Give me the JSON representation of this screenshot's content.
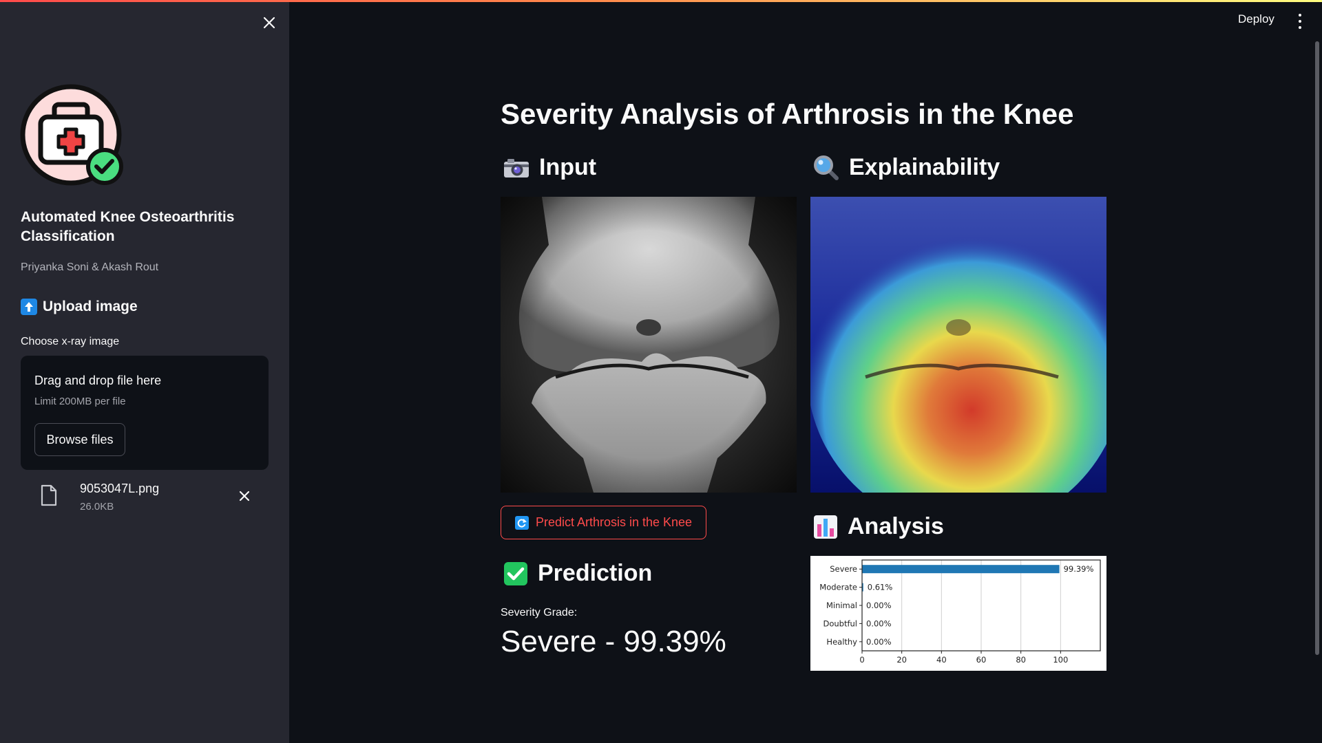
{
  "sidebar": {
    "app_title": "Automated Knee Osteoarthritis Classification",
    "authors": "Priyanka Soni & Akash Rout",
    "upload_header": "Upload image",
    "choose_label": "Choose x-ray image",
    "dropzone": {
      "title": "Drag and drop file here",
      "limit": "Limit 200MB per file",
      "browse_label": "Browse files"
    },
    "file": {
      "name": "9053047L.png",
      "size": "26.0KB"
    }
  },
  "header": {
    "deploy_label": "Deploy"
  },
  "main": {
    "title": "Severity Analysis of Arthrosis in the Knee",
    "input_header": "Input",
    "explainability_header": "Explainability",
    "analysis_header": "Analysis",
    "predict_button": "Predict Arthrosis in the Knee",
    "prediction_header": "Prediction",
    "severity_label": "Severity Grade:",
    "severity_value": "Severe - 99.39%"
  },
  "icons": {
    "input": "camera-icon",
    "explainability": "magnifier-icon",
    "analysis": "bar-chart-icon",
    "prediction": "check-icon",
    "upload": "upload-arrow-icon",
    "logo": "medical-kit-icon"
  },
  "colors": {
    "accent": "#ff4b4b",
    "bar": "#1f77b4",
    "check_green": "#22c55e"
  },
  "chart_data": {
    "type": "bar",
    "orientation": "horizontal",
    "categories": [
      "Severe",
      "Moderate",
      "Minimal",
      "Doubtful",
      "Healthy"
    ],
    "values": [
      99.39,
      0.61,
      0.0,
      0.0,
      0.0
    ],
    "value_labels": [
      "99.39%",
      "0.61%",
      "0.00%",
      "0.00%",
      "0.00%"
    ],
    "xlim": [
      0,
      120
    ],
    "xticks": [
      0,
      20,
      40,
      60,
      80,
      100
    ],
    "grid": true
  }
}
